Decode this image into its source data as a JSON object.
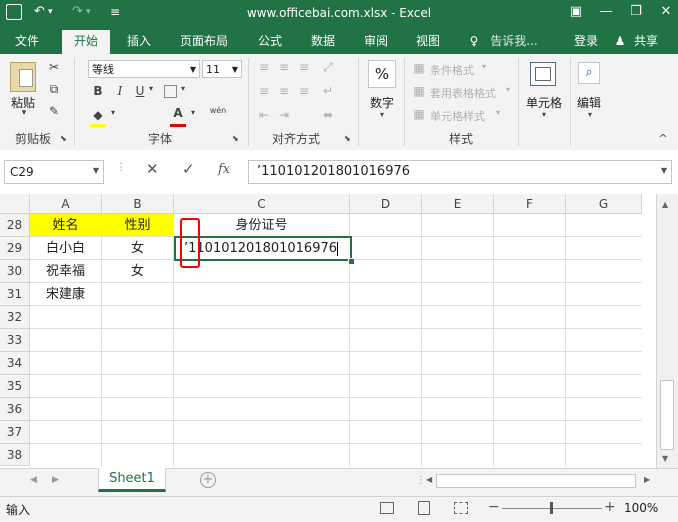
{
  "window": {
    "title": "www.officebai.com.xlsx - Excel",
    "quick_access": {
      "undo": "↶",
      "redo": "↷",
      "customize": "≡"
    },
    "controls": {
      "ribbon_options": "▣",
      "minimize": "—",
      "restore": "❐",
      "close": "✕"
    }
  },
  "tabs": [
    "文件",
    "开始",
    "插入",
    "页面布局",
    "公式",
    "数据",
    "审阅",
    "视图"
  ],
  "active_tab": "开始",
  "tell_me": "告诉我...",
  "login": "登录",
  "share": "共享",
  "ribbon": {
    "clipboard": {
      "paste": "粘贴",
      "label": "剪贴板"
    },
    "font": {
      "name": "等线",
      "size": "11",
      "bold": "B",
      "italic": "I",
      "underline": "U",
      "font_color": "A",
      "phonetic": "wén",
      "label": "字体"
    },
    "alignment": {
      "label": "对齐方式"
    },
    "number": {
      "icon": "%",
      "button": "数字"
    },
    "styles": {
      "conditional": "条件格式",
      "table_format": "套用表格格式",
      "cell_style": "单元格样式",
      "label": "样式"
    },
    "cells": {
      "button": "单元格"
    },
    "editing": {
      "button": "编辑"
    }
  },
  "formula_bar": {
    "name_box": "C29",
    "cancel": "✕",
    "enter": "✓",
    "fx": "fx",
    "content": "’110101201801016976"
  },
  "sheet": {
    "columns": [
      "A",
      "B",
      "C",
      "D",
      "E",
      "F",
      "G"
    ],
    "rows": [
      "28",
      "29",
      "30",
      "31",
      "32",
      "33",
      "34",
      "35",
      "36",
      "37",
      "38"
    ],
    "cells": {
      "A28": "姓名",
      "B28": "性别",
      "C28": "身份证号",
      "A29": "白小白",
      "B29": "女",
      "C29": "’110101201801016976",
      "A30": "祝幸福",
      "B30": "女",
      "A31": "宋建康"
    },
    "highlight_color": "#ffff00",
    "active_cell": "C29"
  },
  "sheet_tabs": [
    "Sheet1"
  ],
  "status": {
    "mode": "输入",
    "zoom": "100%",
    "minus": "−",
    "plus": "+"
  },
  "colors": {
    "brand": "#217346",
    "annotation": "#ff0000"
  }
}
